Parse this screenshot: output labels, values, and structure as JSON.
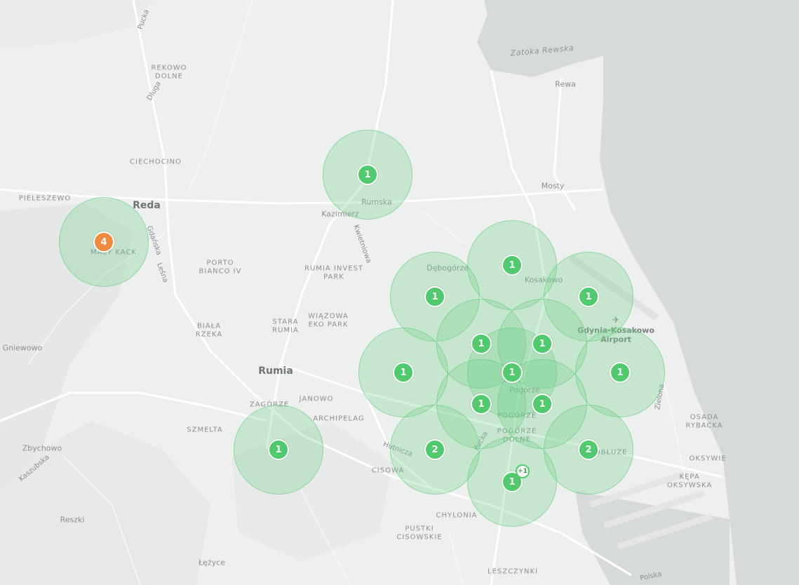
{
  "map": {
    "water_labels": [
      "Zatoka Rewska"
    ],
    "towns": [
      "Reda",
      "Rumia"
    ],
    "places": [
      "Rewa",
      "Mosty",
      "Rumska",
      "Kazimierz",
      "Dębogórze",
      "Kosakowo",
      "Pogórze",
      "Gniewowo",
      "Zbychowo",
      "Reszki",
      "Łężyce"
    ],
    "districts": [
      "REKOWO DOLNE",
      "CIECHOCINO",
      "PIELESZEWO",
      "PORTO BIANCO IV",
      "RUMIA INVEST PARK",
      "BIAŁA RZEKA",
      "STARA RUMIA",
      "WIĄZOWA EKO PARK",
      "ZAGÓRZE",
      "JANOWO",
      "SZMELTA",
      "ARCHIPELAG",
      "CISOWA",
      "CHYLONIA",
      "PUSTKI CISOWSKIE",
      "LESZCZYNKI",
      "OKSYWIE",
      "KĘPA OKSYWSKA",
      "OSADA RYBACKA",
      "POGÓRZE DOLNE",
      "POGÓRZE",
      "OBŁUŻE",
      "MAŁY KACK"
    ],
    "roads": [
      "Pucka",
      "Długa",
      "Gdańska",
      "Leśna",
      "Kwietniowa",
      "Hutnicza",
      "Pucka",
      "Zielona",
      "Kaszubska",
      "Polska"
    ],
    "airport_label": "Gdynia-Kosakowo Airport",
    "airport_icon": "airplane-icon"
  },
  "colors": {
    "cluster_green": "#4fcb6d",
    "cluster_orange": "#f08a3e",
    "area_fill": "#6ed287",
    "sea": "#d7dadb",
    "land": "#eef0ef"
  },
  "clusters": [
    {
      "count": "4",
      "color": "orange"
    },
    {
      "count": "1",
      "color": "green"
    },
    {
      "count": "1",
      "color": "green"
    },
    {
      "count": "1",
      "color": "green"
    },
    {
      "count": "1",
      "color": "green"
    },
    {
      "count": "1",
      "color": "green"
    },
    {
      "count": "1",
      "color": "green"
    },
    {
      "count": "1",
      "color": "green"
    },
    {
      "count": "1",
      "color": "green"
    },
    {
      "count": "1",
      "color": "green"
    },
    {
      "count": "1",
      "color": "green"
    },
    {
      "count": "1",
      "color": "green"
    },
    {
      "count": "1",
      "color": "green"
    },
    {
      "count": "2",
      "color": "green"
    },
    {
      "count": "2",
      "color": "green"
    },
    {
      "count": "1",
      "color": "green",
      "extra": "+1"
    }
  ]
}
